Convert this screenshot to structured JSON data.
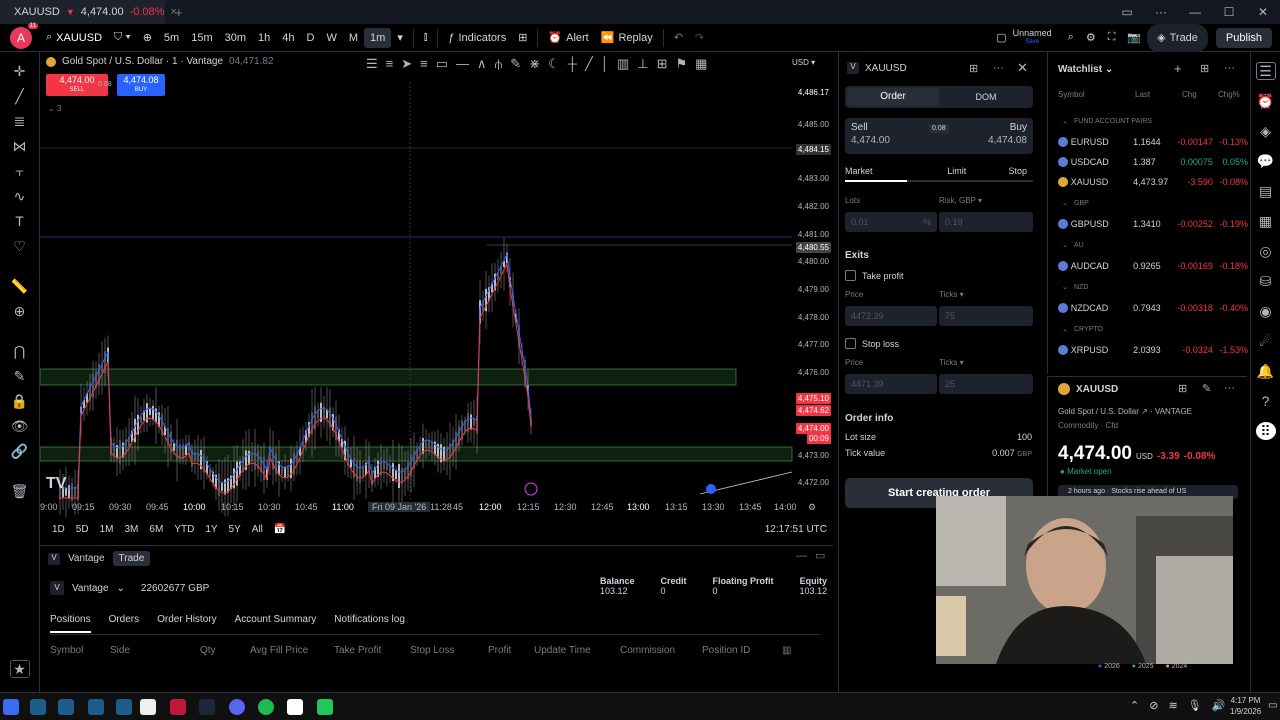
{
  "titlebar": {
    "tab_symbol": "XAUUSD",
    "tab_price": "4,474.00",
    "tab_change": "-0.08%",
    "close_tab": "×",
    "new_tab": "+"
  },
  "toolbar": {
    "symbol": "XAUUSD",
    "intervals": [
      "5m",
      "15m",
      "30m",
      "1h",
      "4h",
      "D",
      "W",
      "M",
      "1m"
    ],
    "active_interval": "1m",
    "indicators": "Indicators",
    "alert": "Alert",
    "replay": "Replay",
    "layout_name": "Unnamed",
    "layout_sub": "Save",
    "trade": "Trade",
    "publish": "Publish",
    "avatar_letter": "A",
    "avatar_badge": "11"
  },
  "chart": {
    "legend_symbol": "Gold Spot / U.S. Dollar · 1 · Vantage",
    "legend_price": "04,471.82",
    "sell_price": "4,474.00",
    "sell_label": "SELL",
    "spread": "0.08",
    "buy_price": "4,474.08",
    "buy_label": "BUY",
    "indicator_count": "3",
    "currency": "USD",
    "price_labels": [
      "4,486.17",
      "4,485.00",
      "4,484.15",
      "4,483.00",
      "4,482.00",
      "4,481.00",
      "4,480.55",
      "4,480.00",
      "4,479.00",
      "4,478.00",
      "4,477.00",
      "4,476.00",
      "4,475.10",
      "4,474.62",
      "4,474.00",
      "00:09",
      "4,473.00",
      "4,472.00"
    ],
    "time_labels": [
      "9:00",
      "09:15",
      "09:30",
      "09:45",
      "10:00",
      "10:15",
      "10:30",
      "10:45",
      "11:00",
      "Fri 09 Jan '26",
      "11:28",
      "45",
      "12:00",
      "12:15",
      "12:30",
      "12:45",
      "13:00",
      "13:15",
      "13:30",
      "13:45",
      "14:00"
    ],
    "clock": "12:17:51 UTC",
    "ranges": [
      "1D",
      "5D",
      "1M",
      "3M",
      "6M",
      "YTD",
      "1Y",
      "5Y",
      "All"
    ]
  },
  "bottom": {
    "broker": "Vantage",
    "trade_tab": "Trade",
    "account_id": "22602677 GBP",
    "balance_label": "Balance",
    "balance": "103.12",
    "credit_label": "Credit",
    "credit": "0",
    "floating_label": "Floating Profit",
    "floating": "0",
    "equity_label": "Equity",
    "equity": "103.12",
    "tabs": [
      "Positions",
      "Orders",
      "Order History",
      "Account Summary",
      "Notifications log"
    ],
    "columns": [
      "Symbol",
      "Side",
      "Qty",
      "Avg Fill Price",
      "Take Profit",
      "Stop Loss",
      "Profit",
      "Update Time",
      "Commission",
      "Position ID"
    ]
  },
  "order": {
    "symbol": "XAUUSD",
    "tab_order": "Order",
    "tab_dom": "DOM",
    "sell_label": "Sell",
    "sell_price": "4,474.00",
    "spread": "0.08",
    "buy_label": "Buy",
    "buy_price": "4,474.08",
    "types": [
      "Market",
      "Limit",
      "Stop"
    ],
    "lots_label": "Lots",
    "lots_value": "0.01",
    "lots_pct": "%",
    "risk_label": "Risk, GBP",
    "risk_value": "0.19",
    "exits": "Exits",
    "tp_label": "Take profit",
    "price_label": "Price",
    "ticks_label": "Ticks",
    "tp_price": "4472.39",
    "tp_ticks": "75",
    "sl_label": "Stop loss",
    "sl_price": "4471.39",
    "sl_ticks": "25",
    "order_info": "Order info",
    "lot_size_label": "Lot size",
    "lot_size": "100",
    "tick_value_label": "Tick value",
    "tick_value": "0.007",
    "tick_value_unit": "GBP",
    "start_button": "Start creating order"
  },
  "watchlist": {
    "title": "Watchlist",
    "columns": [
      "Symbol",
      "Last",
      "Chg",
      "Chg%"
    ],
    "groups": [
      {
        "name": "FUND ACCOUNT PAIRS",
        "rows": [
          {
            "symbol": "EURUSD",
            "last": "1.1644",
            "chg": "-0.00147",
            "chgp": "-0.13%",
            "neg": true
          },
          {
            "symbol": "USDCAD",
            "last": "1.387",
            "chg": "0.00075",
            "chgp": "0.05%",
            "neg": false
          },
          {
            "symbol": "XAUUSD",
            "last": "4,473.97",
            "chg": "-3.590",
            "chgp": "-0.08%",
            "neg": true
          }
        ]
      },
      {
        "name": "GBP",
        "rows": [
          {
            "symbol": "GBPUSD",
            "last": "1.3410",
            "chg": "-0.00252",
            "chgp": "-0.19%",
            "neg": true
          }
        ]
      },
      {
        "name": "AU",
        "rows": [
          {
            "symbol": "AUDCAD",
            "last": "0.9265",
            "chg": "-0.00169",
            "chgp": "-0.18%",
            "neg": true
          }
        ]
      },
      {
        "name": "NZD",
        "rows": [
          {
            "symbol": "NZDCAD",
            "last": "0.7943",
            "chg": "-0.00318",
            "chgp": "-0.40%",
            "neg": true
          }
        ]
      },
      {
        "name": "CRYPTO",
        "rows": [
          {
            "symbol": "XRPUSD",
            "last": "2.0393",
            "chg": "-0.0324",
            "chgp": "-1.53%",
            "neg": true
          }
        ]
      }
    ]
  },
  "detail": {
    "symbol": "XAUUSD",
    "name": "Gold Spot / U.S. Dollar",
    "exchange": "VANTAGE",
    "category": "Commodity · Cfd",
    "price": "4,474.00",
    "currency": "USD",
    "change": "-3.39",
    "change_pct": "-0.08%",
    "market_status": "Market open",
    "news": "2 hours ago · Stocks rise ahead of US"
  },
  "webcam": {
    "legend": [
      "2026",
      "2025",
      "2024"
    ]
  },
  "taskbar": {
    "time": "4:17 PM",
    "date": "1/9/2026"
  },
  "colors": {
    "bg": "#000000",
    "panel": "#131722",
    "red": "#f23645",
    "green": "#22ab94",
    "blue": "#2962ff",
    "gold": "#e2a53a"
  }
}
